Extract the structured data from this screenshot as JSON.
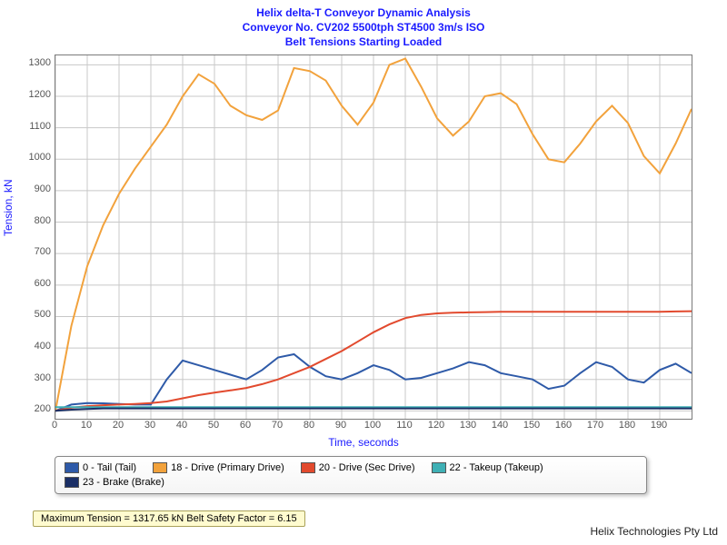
{
  "title": {
    "line1": "Helix delta-T Conveyor Dynamic Analysis",
    "line2": "Conveyor No. CV202 5500tph ST4500 3m/s ISO",
    "line3": "Belt Tensions Starting Loaded"
  },
  "axes": {
    "xlabel": "Time, seconds",
    "ylabel": "Tension, kN"
  },
  "legend": {
    "items": [
      {
        "label": "0 - Tail (Tail)",
        "color": "#2e5aa8"
      },
      {
        "label": "18 - Drive (Primary Drive)",
        "color": "#f2a23c"
      },
      {
        "label": "20 - Drive (Sec Drive)",
        "color": "#e24a2e"
      },
      {
        "label": "22 - Takeup (Takeup)",
        "color": "#3fb0b5"
      },
      {
        "label": "23 - Brake (Brake)",
        "color": "#1b2f66"
      }
    ]
  },
  "maxnote": "Maximum Tension = 1317.65 kN Belt Safety Factor = 6.15",
  "footer": "Helix Technologies Pty Ltd",
  "colors": {
    "tail": "#2e5aa8",
    "primary": "#f2a23c",
    "sec": "#e24a2e",
    "takeup": "#3fb0b5",
    "brake": "#1b2f66",
    "grid": "#c8c8c8",
    "titles": "#1a1aff"
  },
  "chart_data": {
    "type": "line",
    "xlabel": "Time, seconds",
    "ylabel": "Tension, kN",
    "xlim": [
      0,
      200
    ],
    "ylim": [
      175,
      1330
    ],
    "xticks": [
      0,
      10,
      20,
      30,
      40,
      50,
      60,
      70,
      80,
      90,
      100,
      110,
      120,
      130,
      140,
      150,
      160,
      170,
      180,
      190
    ],
    "yticks": [
      200,
      300,
      400,
      500,
      600,
      700,
      800,
      900,
      1000,
      1100,
      1200,
      1300
    ],
    "x": [
      0,
      5,
      10,
      15,
      20,
      25,
      30,
      35,
      40,
      45,
      50,
      55,
      60,
      65,
      70,
      75,
      80,
      85,
      90,
      95,
      100,
      105,
      110,
      115,
      120,
      125,
      130,
      135,
      140,
      145,
      150,
      155,
      160,
      165,
      170,
      175,
      180,
      185,
      190,
      195,
      200
    ],
    "series": [
      {
        "name": "0 - Tail (Tail)",
        "color": "#2e5aa8",
        "values": [
          200,
          220,
          225,
          224,
          222,
          220,
          220,
          300,
          360,
          345,
          330,
          315,
          300,
          330,
          370,
          380,
          340,
          310,
          300,
          320,
          345,
          330,
          300,
          305,
          320,
          335,
          355,
          345,
          320,
          310,
          300,
          270,
          280,
          320,
          355,
          340,
          300,
          290,
          330,
          350,
          320
        ]
      },
      {
        "name": "18 - Drive (Primary Drive)",
        "color": "#f2a23c",
        "values": [
          200,
          470,
          660,
          790,
          890,
          970,
          1040,
          1110,
          1200,
          1270,
          1240,
          1170,
          1140,
          1125,
          1155,
          1290,
          1280,
          1250,
          1170,
          1110,
          1180,
          1300,
          1320,
          1230,
          1130,
          1075,
          1120,
          1200,
          1210,
          1175,
          1080,
          1000,
          990,
          1050,
          1120,
          1170,
          1115,
          1010,
          955,
          1050,
          1160
        ]
      },
      {
        "name": "20 - Drive (Sec Drive)",
        "color": "#e24a2e",
        "values": [
          200,
          210,
          215,
          218,
          220,
          222,
          225,
          230,
          240,
          250,
          258,
          265,
          273,
          285,
          300,
          320,
          340,
          365,
          390,
          420,
          450,
          475,
          495,
          505,
          510,
          512,
          513,
          514,
          515,
          515,
          515,
          515,
          515,
          515,
          515,
          515,
          515,
          515,
          515,
          516,
          517
        ]
      },
      {
        "name": "22 - Takeup (Takeup)",
        "color": "#3fb0b5",
        "values": [
          212,
          212,
          212,
          212,
          212,
          212,
          212,
          212,
          212,
          212,
          212,
          212,
          212,
          212,
          212,
          212,
          212,
          212,
          212,
          212,
          212,
          212,
          212,
          212,
          212,
          212,
          212,
          212,
          212,
          212,
          212,
          212,
          212,
          212,
          212,
          212,
          212,
          212,
          212,
          212,
          212
        ]
      },
      {
        "name": "23 - Brake (Brake)",
        "color": "#1b2f66",
        "values": [
          200,
          204,
          206,
          208,
          208,
          208,
          208,
          208,
          208,
          208,
          208,
          208,
          208,
          208,
          208,
          208,
          208,
          208,
          208,
          208,
          208,
          208,
          208,
          208,
          208,
          208,
          208,
          208,
          208,
          208,
          208,
          208,
          208,
          208,
          208,
          208,
          208,
          208,
          208,
          208,
          208
        ]
      }
    ]
  }
}
